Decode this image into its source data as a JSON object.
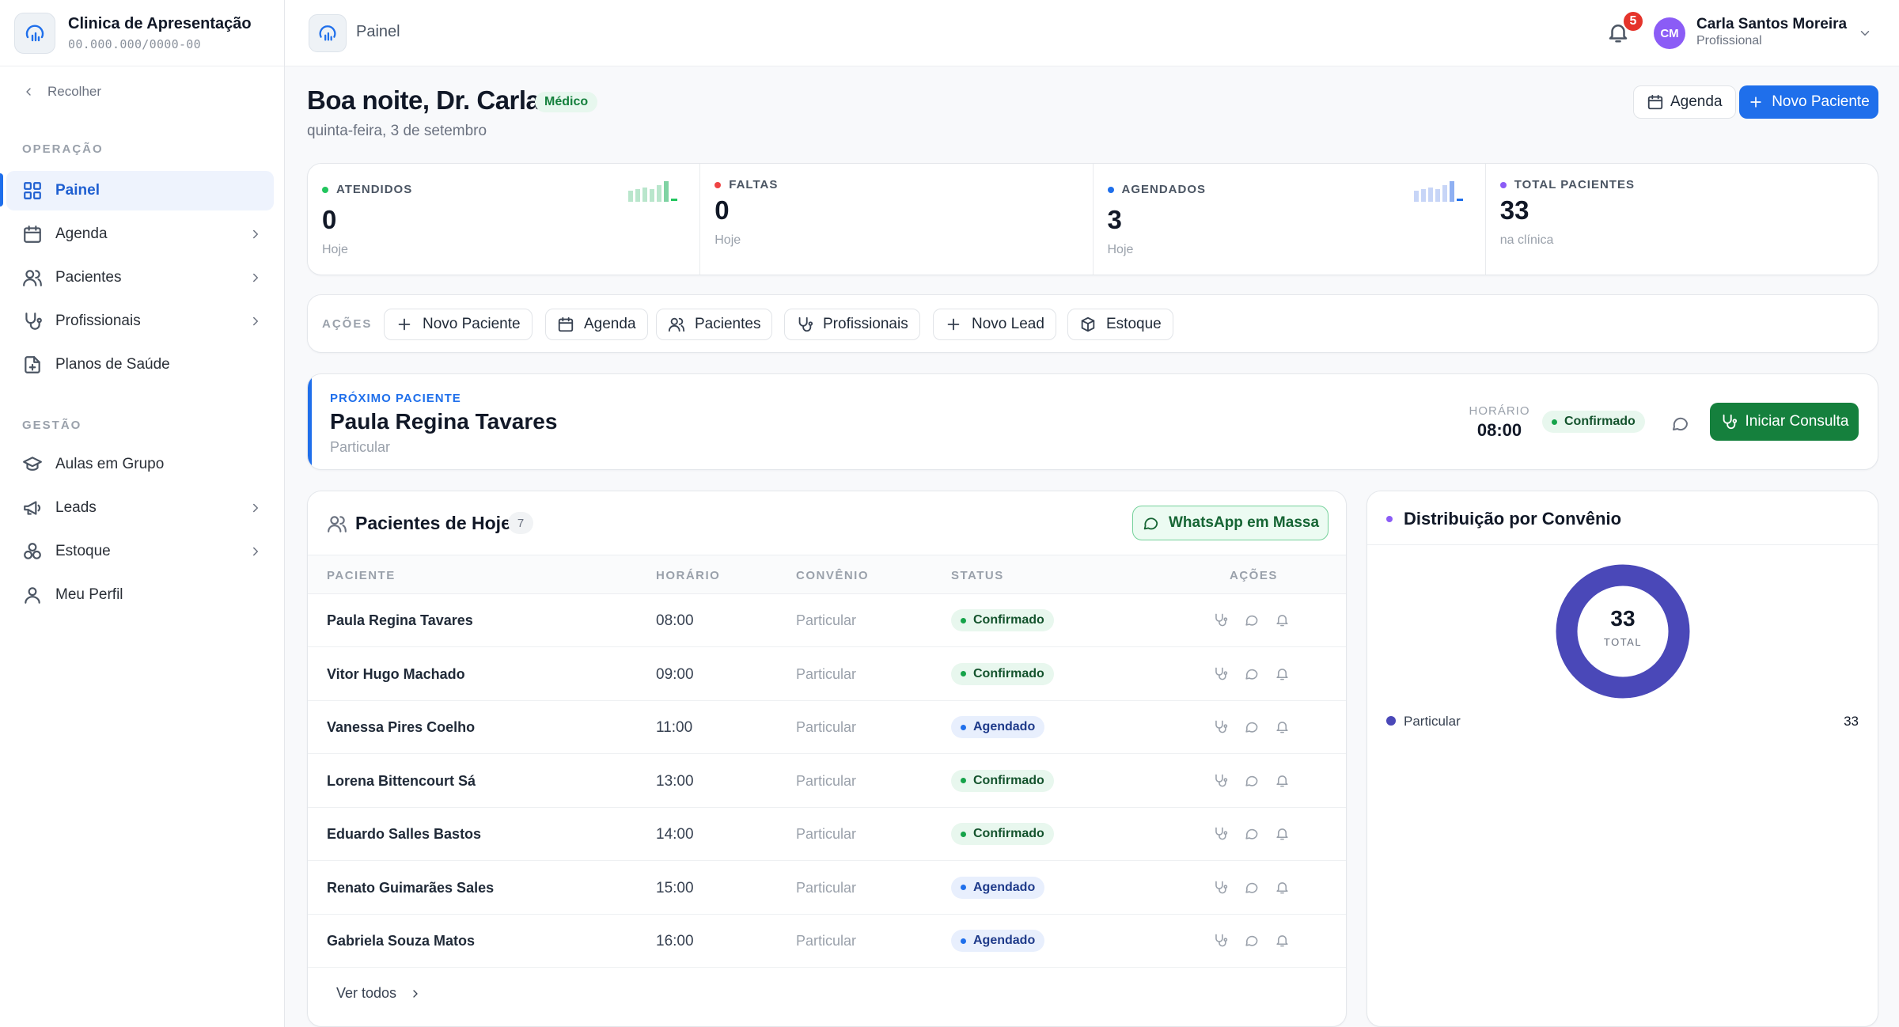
{
  "brand": {
    "name": "Clinica de Apresentação",
    "cnpj": "00.000.000/0000-00"
  },
  "sidebar": {
    "collapse_label": "Recolher",
    "sections": [
      {
        "label": "OPERAÇÃO"
      },
      {
        "label": "GESTÃO"
      }
    ],
    "items": [
      {
        "label": "Painel",
        "icon": "dashboard-icon",
        "active": true
      },
      {
        "label": "Agenda",
        "icon": "calendar-icon"
      },
      {
        "label": "Pacientes",
        "icon": "users-icon"
      },
      {
        "label": "Profissionais",
        "icon": "stethoscope-icon"
      },
      {
        "label": "Planos de Saúde",
        "icon": "document-icon"
      },
      {
        "label": "Aulas em Grupo",
        "icon": "graduation-cap-icon"
      },
      {
        "label": "Leads",
        "icon": "megaphone-icon"
      },
      {
        "label": "Estoque",
        "icon": "boxes-icon"
      },
      {
        "label": "Meu Perfil",
        "icon": "user-icon"
      }
    ]
  },
  "header": {
    "title": "Painel",
    "notifications": "5",
    "user": {
      "initials": "CM",
      "name": "Carla Santos Moreira",
      "role": "Profissional"
    }
  },
  "greeting": {
    "title": "Boa noite, Dr. Carla",
    "role_badge": "Médico",
    "date": "quinta-feira, 3 de setembro",
    "agenda_button": "Agenda",
    "new_patient_button": "Novo Paciente"
  },
  "stats": [
    {
      "label": "ATENDIDOS",
      "value": "0",
      "sub": "Hoje",
      "dot_color": "#22c55e"
    },
    {
      "label": "FALTAS",
      "value": "0",
      "sub": "Hoje",
      "dot_color": "#ef4444"
    },
    {
      "label": "AGENDADOS",
      "value": "3",
      "sub": "Hoje",
      "dot_color": "#1f6feb"
    },
    {
      "label": "TOTAL PACIENTES",
      "value": "33",
      "sub": "na clínica",
      "dot_color": "#8b5cf6"
    }
  ],
  "actions": {
    "label": "AÇÕES",
    "buttons": [
      {
        "label": "Novo Paciente",
        "icon": "plus-icon"
      },
      {
        "label": "Agenda",
        "icon": "calendar-icon"
      },
      {
        "label": "Pacientes",
        "icon": "users-icon"
      },
      {
        "label": "Profissionais",
        "icon": "stethoscope-icon"
      },
      {
        "label": "Novo Lead",
        "icon": "plus-icon"
      },
      {
        "label": "Estoque",
        "icon": "box-icon"
      }
    ]
  },
  "next_patient": {
    "label": "PRÓXIMO PACIENTE",
    "name": "Paula Regina Tavares",
    "plan": "Particular",
    "time_label": "HORÁRIO",
    "time": "08:00",
    "status": "Confirmado",
    "start_button": "Iniciar Consulta"
  },
  "patients_today": {
    "title": "Pacientes de Hoje",
    "count": "7",
    "whatsapp_button": "WhatsApp em Massa",
    "columns": [
      "PACIENTE",
      "HORÁRIO",
      "CONVÊNIO",
      "STATUS",
      "AÇÕES"
    ],
    "rows": [
      {
        "name": "Paula Regina Tavares",
        "time": "08:00",
        "plan": "Particular",
        "status": "Confirmado"
      },
      {
        "name": "Vitor Hugo Machado",
        "time": "09:00",
        "plan": "Particular",
        "status": "Confirmado"
      },
      {
        "name": "Vanessa Pires Coelho",
        "time": "11:00",
        "plan": "Particular",
        "status": "Agendado"
      },
      {
        "name": "Lorena Bittencourt Sá",
        "time": "13:00",
        "plan": "Particular",
        "status": "Confirmado"
      },
      {
        "name": "Eduardo Salles Bastos",
        "time": "14:00",
        "plan": "Particular",
        "status": "Confirmado"
      },
      {
        "name": "Renato Guimarães Sales",
        "time": "15:00",
        "plan": "Particular",
        "status": "Agendado"
      },
      {
        "name": "Gabriela Souza Matos",
        "time": "16:00",
        "plan": "Particular",
        "status": "Agendado"
      }
    ],
    "see_all": "Ver todos"
  },
  "distribution": {
    "title": "Distribuição por Convênio",
    "total": "33",
    "total_label": "TOTAL",
    "legend": [
      {
        "name": "Particular",
        "value": "33",
        "color": "#4a48b8"
      }
    ]
  }
}
